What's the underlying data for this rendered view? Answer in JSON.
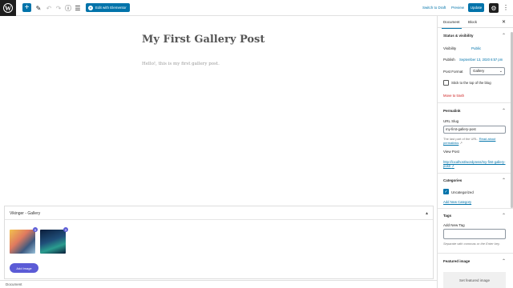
{
  "topbar": {
    "edit_elementor_label": "Edit with Elementor",
    "switch_to_draft": "Switch to Draft",
    "preview": "Preview",
    "update": "Update"
  },
  "editor": {
    "title": "My First Gallery Post",
    "body": "Hello!, this is my first gallery post."
  },
  "gallery": {
    "title": "Vikinger - Gallery",
    "add_image": "Add Image"
  },
  "footer": {
    "label": "Document"
  },
  "sidebar": {
    "tabs": [
      "Document",
      "Block"
    ],
    "status": {
      "title": "Status & visibility",
      "visibility_label": "Visibility",
      "visibility_value": "Public",
      "publish_label": "Publish",
      "publish_value": "September 13, 2020 6:57 pm",
      "post_format_label": "Post Format",
      "post_format_value": "Gallery",
      "sticky_label": "Stick to the top of the blog",
      "trash": "Move to trash"
    },
    "permalink": {
      "title": "Permalink",
      "url_slug_label": "URL Slug",
      "url_slug_value": "my-first-gallery-post",
      "help_text": "The last part of the URL.",
      "help_link": "Read about permalinks",
      "view_post_label": "View Post",
      "view_post_url": "http://localhost/wordpress/my-first-gallery-post/"
    },
    "categories": {
      "title": "Categories",
      "item": "Uncategorized",
      "add_new": "Add New Category"
    },
    "tags": {
      "title": "Tags",
      "add_label": "Add New Tag",
      "help": "Separate with commas or the Enter key."
    },
    "featured": {
      "title": "Featured image",
      "button": "Set featured image"
    }
  }
}
